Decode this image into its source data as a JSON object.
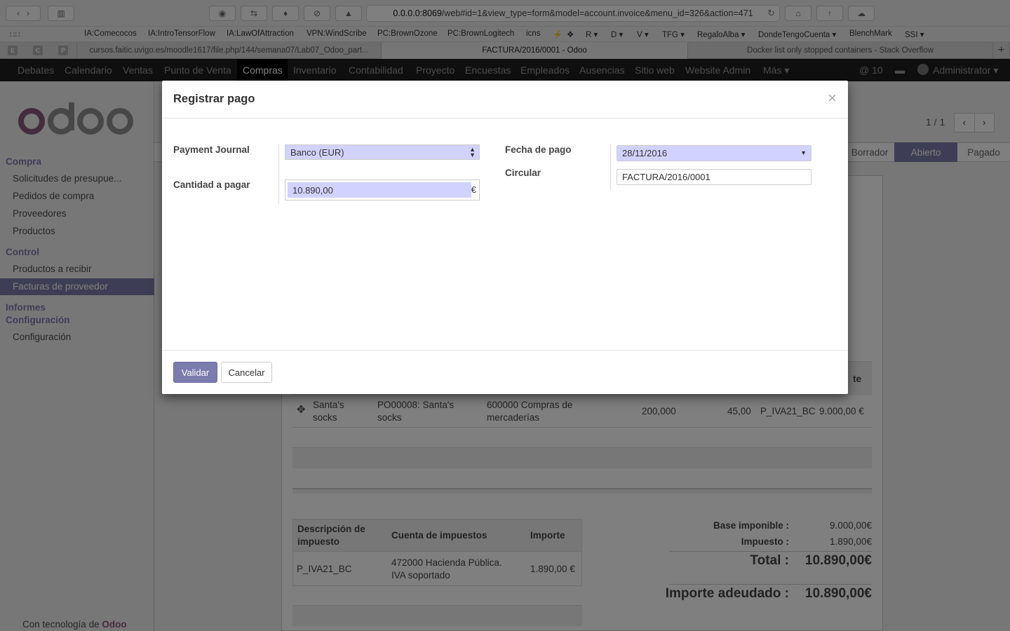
{
  "browser": {
    "url_domain": "0.0.0.0:8069",
    "url_path": "/web#id=1&view_type=form&model=account.invoice&menu_id=326&action=471",
    "bookmarks": [
      "IA:Comecocos",
      "IA:IntroTensorFlow",
      "IA:LawOfAttraction",
      "VPN:WindScribe",
      "PC:BrownOzone",
      "PC:BrownLogitech",
      "icns",
      "⚡",
      "❖",
      "R ▾",
      "D ▾",
      "V ▾",
      "TFG ▾",
      "RegaloAlba ▾",
      "DondeTengoCuenta ▾",
      "BlenchMark",
      "SSI ▾"
    ],
    "tabs": [
      {
        "favicons": [
          "E",
          "C",
          "P"
        ]
      },
      {
        "label": "cursos.faitic.uvigo.es/moodle1617/file.php/144/semana07/Lab07_Odoo_part..."
      },
      {
        "label": "FACTURA/2016/0001 - Odoo"
      },
      {
        "label": "Docker list only stopped containers - Stack Overflow"
      }
    ]
  },
  "nav": {
    "menus": [
      "Debates",
      "Calendario",
      "Ventas",
      "Punto de Venta",
      "Compras",
      "Inventario",
      "Contabilidad",
      "Proyecto",
      "Encuestas",
      "Empleados",
      "Ausencias",
      "Sitio web",
      "Website Admin",
      "Más ▾"
    ],
    "messages": "@ 10",
    "user": "Administrator ▾"
  },
  "sidebar": {
    "sections": [
      {
        "title": "Compra",
        "items": [
          "Solicitudes de presupue...",
          "Pedidos de compra",
          "Proveedores",
          "Productos"
        ]
      },
      {
        "title": "Control",
        "items": [
          "Productos a recibir",
          "Facturas de proveedor"
        ]
      },
      {
        "title": "Informes",
        "items": []
      },
      {
        "title": "Configuración",
        "items": [
          "Configuración"
        ]
      }
    ],
    "footer_prefix": "Con tecnología de",
    "footer_brand": "Odoo",
    "logo": "odoo"
  },
  "form": {
    "pager": "1 / 1",
    "statuses": [
      "Borrador",
      "Abierto",
      "Pagado"
    ],
    "line_header_tail": "te",
    "line": {
      "product": "Santa's socks",
      "source": "PO00008: Santa's socks",
      "account": "600000 Compras de mercaderías",
      "qty": "200,000",
      "price": "45,00",
      "tax": "P_IVA21_BC",
      "amount": "9.000,00 €"
    },
    "tax_table": {
      "headers": [
        "Descripción de impuesto",
        "Cuenta de impuestos",
        "Importe"
      ],
      "row": [
        "P_IVA21_BC",
        "472000 Hacienda Pública. IVA soportado",
        "1.890,00 €"
      ]
    },
    "totals": {
      "base_label": "Base imponible :",
      "base_value": "9.000,00€",
      "tax_label": "Impuesto :",
      "tax_value": "1.890,00€",
      "total_label": "Total :",
      "total_value": "10.890,00€",
      "due_label": "Importe adeudado :",
      "due_value": "10.890,00€"
    }
  },
  "dialog": {
    "title": "Registrar pago",
    "journal_label": "Payment Journal",
    "journal_value": "Banco (EUR)",
    "amount_label": "Cantidad a pagar",
    "amount_value": "10.890,00",
    "currency": "€",
    "date_label": "Fecha de pago",
    "date_value": "28/11/2016",
    "memo_label": "Circular",
    "memo_value": "FACTURA/2016/0001",
    "validate": "Validar",
    "cancel": "Cancelar"
  },
  "colors": {
    "accent": "#7c7bad",
    "field_required": "#d2d2ff",
    "nav_bg": "#1f1f1f"
  }
}
